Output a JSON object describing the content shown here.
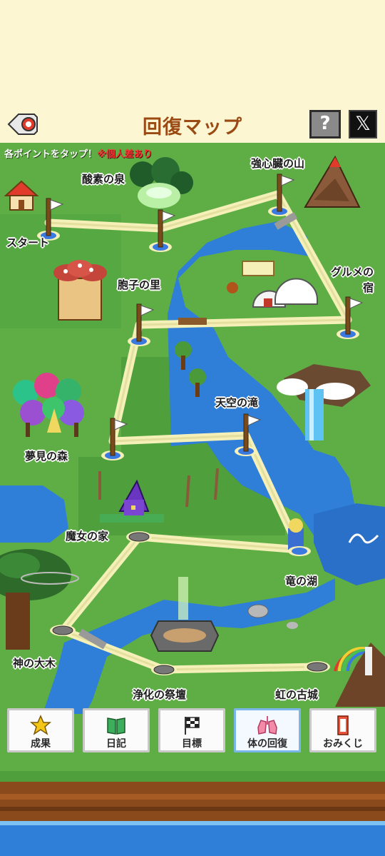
{
  "header": {
    "title": "回復マップ",
    "help_label": "?",
    "x_label": "𝕏"
  },
  "map": {
    "hint": "各ポイントをタップ！",
    "hint_warning": "※個人差あり",
    "locations": [
      {
        "id": "start",
        "label": "スタート"
      },
      {
        "id": "oxygen-spring",
        "label": "酸素の泉"
      },
      {
        "id": "heart-mountain",
        "label": "強心臓の山"
      },
      {
        "id": "spore-village",
        "label": "胞子の里"
      },
      {
        "id": "gourmet-inn",
        "label": "グルメの\n宿"
      },
      {
        "id": "sky-falls",
        "label": "天空の滝"
      },
      {
        "id": "dream-forest",
        "label": "夢見の森"
      },
      {
        "id": "witch-house",
        "label": "魔女の家"
      },
      {
        "id": "dragon-lake",
        "label": "竜の湖"
      },
      {
        "id": "great-tree",
        "label": "神の大木"
      },
      {
        "id": "purify-altar",
        "label": "浄化の祭壇"
      },
      {
        "id": "rainbow-castle",
        "label": "虹の古城"
      }
    ]
  },
  "nav": {
    "items": [
      {
        "label": "成果",
        "icon": "star-icon"
      },
      {
        "label": "日記",
        "icon": "book-icon"
      },
      {
        "label": "目標",
        "icon": "checkered-flag-icon"
      },
      {
        "label": "体の回復",
        "icon": "lungs-icon",
        "active": true
      },
      {
        "label": "おみくじ",
        "icon": "omikuji-icon"
      }
    ]
  },
  "colors": {
    "title": "#9a4a12",
    "grass": "#5fae45",
    "path": "#f4f0b8",
    "river": "#2f7fd8",
    "warning": "#ff3333",
    "active_border": "#7ab6ea"
  }
}
